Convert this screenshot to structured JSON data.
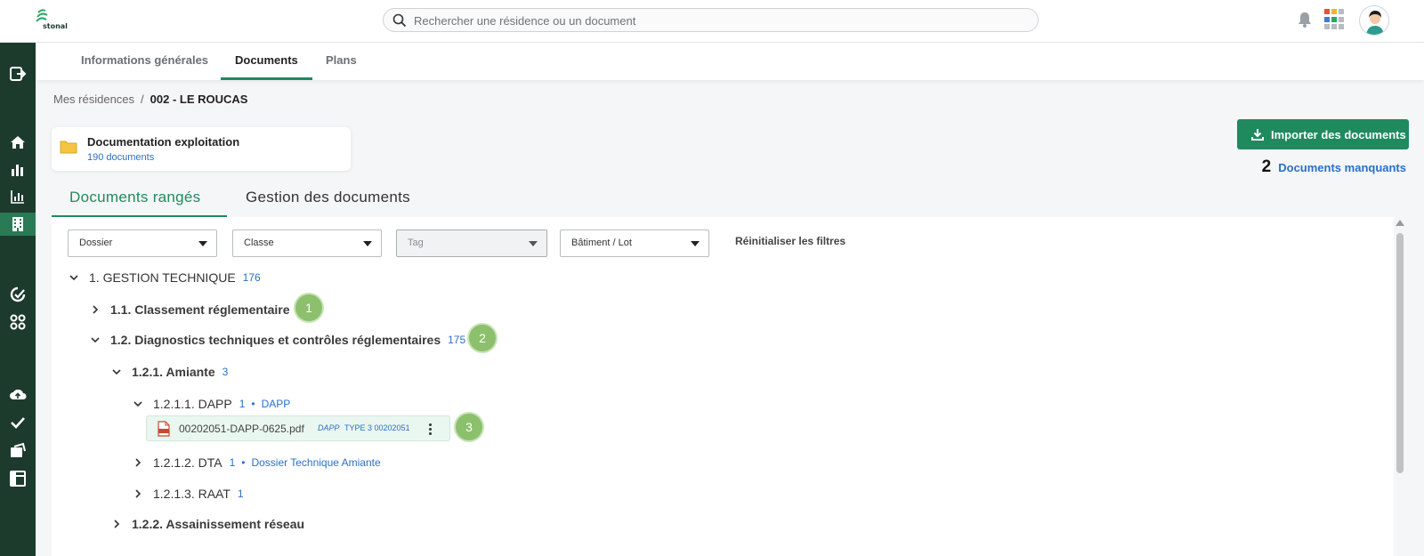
{
  "app": {
    "logo_text": "stonal"
  },
  "search": {
    "placeholder": "Rechercher une résidence ou un document"
  },
  "tabs": [
    {
      "label": "Informations générales"
    },
    {
      "label": "Documents"
    },
    {
      "label": "Plans"
    }
  ],
  "breadcrumb": {
    "root": "Mes résidences",
    "separator": "/",
    "current": "002 - LE ROUCAS"
  },
  "folder_card": {
    "title": "Documentation exploitation",
    "count": "190 documents"
  },
  "actions": {
    "import_label": "Importer des documents",
    "missing_count": "2",
    "missing_label": "Documents manquants"
  },
  "doc_tabs": [
    {
      "label": "Documents rangés"
    },
    {
      "label": "Gestion des documents"
    }
  ],
  "filters": {
    "dossier": "Dossier",
    "classe": "Classe",
    "tag": "Tag",
    "batiment": "Bâtiment / Lot",
    "reset": "Réinitialiser les filtres"
  },
  "tree": {
    "n1": {
      "label": "1. GESTION TECHNIQUE",
      "count": "176"
    },
    "n1_1": {
      "label": "1.1. Classement réglementaire"
    },
    "n1_2": {
      "label": "1.2. Diagnostics techniques et contrôles réglementaires",
      "count": "175"
    },
    "n1_2_1": {
      "label": "1.2.1. Amiante",
      "count": "3"
    },
    "n1_2_1_1": {
      "label": "1.2.1.1. DAPP",
      "count": "1",
      "dot": "•",
      "classe": "DAPP"
    },
    "file": {
      "name": "00202051-DAPP-0625.pdf",
      "tag": "DAPP",
      "type": "TYPE 3 00202051"
    },
    "n1_2_1_2": {
      "label": "1.2.1.2. DTA",
      "count": "1",
      "dot": "•",
      "classe": "Dossier Technique Amiante"
    },
    "n1_2_1_3": {
      "label": "1.2.1.3. RAAT",
      "count": "1"
    },
    "n1_2_2": {
      "label": "1.2.2. Assainissement réseau"
    }
  },
  "steps": [
    "1",
    "2",
    "3"
  ],
  "colors": {
    "brand": "#1f8a5e",
    "sidebar": "#1d3b2d",
    "link": "#2a6fc9",
    "step_badge": "#8cc06c",
    "folder": "#f5c542"
  },
  "icons": {
    "sidebar": [
      "logout-icon",
      "home-icon",
      "bar-chart-icon",
      "analytics-icon",
      "building-icon",
      "sync-icon",
      "apps-icon",
      "cloud-upload-icon",
      "check-icon",
      "documents-icon",
      "layout-icon"
    ],
    "topbar": [
      "search-icon",
      "bell-icon",
      "app-grid-icon",
      "avatar"
    ]
  }
}
